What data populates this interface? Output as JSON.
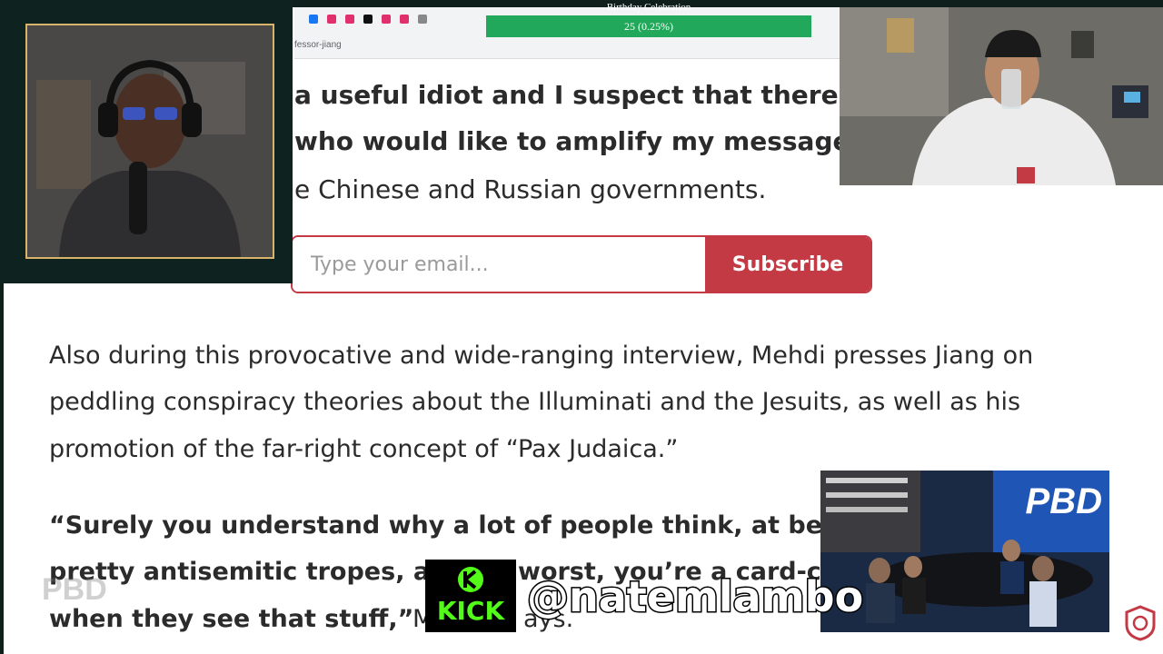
{
  "browser": {
    "url_fragment": "fessor-jiang",
    "tab_icon_colors": [
      "#1877f2",
      "#e1306c",
      "#e1306c",
      "#111111",
      "#e1306c",
      "#e1306c",
      "#888888"
    ]
  },
  "article": {
    "quote_line_1": "a useful idiot and I suspect that there ar",
    "quote_line_2": "who would like to amplify my message,”",
    "quote_line_3": "e Chinese and Russian governments.",
    "para_line_1": "Also during this provocative and wide-ranging interview, Mehdi presses Jiang on",
    "para_line_2": "peddling conspiracy theories about the Illuminati and the Jesuits, as well as his",
    "para_line_3": "promotion of the far-right concept of “Pax Judaica.”",
    "quote2_line_1": "“Surely you understand why a lot of people think, at best",
    "quote2_line_2": "pretty antisemitic tropes, a",
    "quote2_line_2b": "worst, you’re a card-ca",
    "quote2_line_3": "when they see that stuff,”",
    "quote2_line_3b": "M",
    "quote2_line_3c": "ays."
  },
  "subscribe": {
    "placeholder": "Type your email...",
    "button_label": "Subscribe"
  },
  "goal": {
    "title": "Birthday Celebration",
    "progress_text": "25 (0.25%)",
    "progress_fraction": 0.0025
  },
  "overlay": {
    "kick_label": "KICK",
    "handle": "@natemlambo",
    "pbd_logo": "PBD",
    "pbd_watermark": "PBD"
  },
  "colors": {
    "accent": "#c33a45",
    "kick_green": "#53fc18",
    "progress_green": "#21a85a",
    "frame_gold": "#d7b46a"
  }
}
